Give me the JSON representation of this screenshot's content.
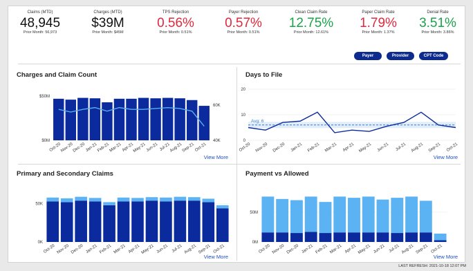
{
  "kpis": [
    {
      "title": "Claims (MTD)",
      "value": "48,945",
      "prior": "Prior Month: 56,973",
      "color": "black"
    },
    {
      "title": "Charges (MTD)",
      "value": "$39M",
      "prior": "Prior Month: $45M",
      "color": "black"
    },
    {
      "title": "TPS Rejection",
      "value": "0.56%",
      "prior": "Prior Month: 0.51%",
      "color": "red"
    },
    {
      "title": "Payer Rejection",
      "value": "0.57%",
      "prior": "Prior Month: 0.51%",
      "color": "red"
    },
    {
      "title": "Clean Claim Rate",
      "value": "12.75%",
      "prior": "Prior Month: 12.61%",
      "color": "green"
    },
    {
      "title": "Paper Claim Rate",
      "value": "1.79%",
      "prior": "Prior Month: 1.37%",
      "color": "red"
    },
    {
      "title": "Denial Rate",
      "value": "3.51%",
      "prior": "Prior Month: 3.86%",
      "color": "green"
    }
  ],
  "filters": {
    "payer": "Payer",
    "provider": "Provider",
    "cpt_code": "CPT Code"
  },
  "view_more": "View More",
  "last_refresh": "LAST REFRESH: 2021-10-18 12:07 PM",
  "colors": {
    "dark_blue": "#0b2a9e",
    "light_blue": "#5cb3f3",
    "line_blue": "#5aaee8",
    "dtf_line": "#0b2a9e",
    "dtf_avg": "#3b7bd1",
    "red": "#e0283c",
    "green": "#1aa34a"
  },
  "chart_data": [
    {
      "type": "bar",
      "title": "Charges and Claim Count",
      "categories": [
        "Oct-20",
        "Nov-20",
        "Dec-20",
        "Jan-21",
        "Feb-21",
        "Mar-21",
        "Apr-21",
        "May-21",
        "Jun-21",
        "Jul-21",
        "Aug-21",
        "Sep-21",
        "Oct-21"
      ],
      "series": [
        {
          "kind": "bar",
          "axis": "left",
          "values": [
            47,
            46,
            48,
            47.5,
            43,
            47,
            47,
            48,
            47.5,
            48,
            47.5,
            45.5,
            39
          ]
        },
        {
          "kind": "line",
          "axis": "right",
          "values": [
            57.5,
            56,
            57.5,
            58.5,
            56.5,
            58.5,
            57.5,
            57.5,
            58,
            58.5,
            58,
            56.5,
            48
          ]
        }
      ],
      "ylim": [
        0,
        50
      ],
      "y2lim": [
        40,
        65
      ],
      "yticks": [
        "$0M",
        "$50M"
      ],
      "y2ticks": [
        "40K",
        "60K"
      ],
      "xlabel": "",
      "ylabel": ""
    },
    {
      "type": "line",
      "title": "Days to File",
      "categories": [
        "Oct-20",
        "Nov-20",
        "Dec-20",
        "Jan-21",
        "Feb-21",
        "Mar-21",
        "Apr-21",
        "May-21",
        "Jun-21",
        "Jul-21",
        "Aug-21",
        "Sep-21",
        "Oct-21"
      ],
      "series": [
        {
          "values": [
            5,
            4,
            7,
            7.5,
            11,
            3,
            4,
            3.5,
            5.5,
            7,
            11,
            6,
            5
          ]
        }
      ],
      "average": 6,
      "average_label": "Avg: 6",
      "ylim": [
        0,
        20
      ],
      "yticks": [
        "0",
        "10",
        "20"
      ],
      "xlabel": "",
      "ylabel": ""
    },
    {
      "type": "bar",
      "stacked": true,
      "title": "Primary and Secondary Claims",
      "categories": [
        "Oct-20",
        "Nov-20",
        "Dec-20",
        "Jan-21",
        "Feb-21",
        "Mar-21",
        "Apr-21",
        "May-21",
        "Jun-21",
        "Jul-21",
        "Aug-21",
        "Sep-21",
        "Oct-21"
      ],
      "series": [
        {
          "values": [
            53,
            52,
            54,
            53,
            48,
            53,
            53,
            54,
            53,
            54,
            54,
            52,
            44
          ]
        },
        {
          "values": [
            5,
            5,
            5,
            4.5,
            4,
            5,
            4.5,
            4.5,
            5,
            5,
            4.5,
            4.5,
            4
          ]
        }
      ],
      "ylim": [
        0,
        65
      ],
      "yticks": [
        "0K",
        "50K"
      ],
      "xlabel": "",
      "ylabel": ""
    },
    {
      "type": "bar",
      "stacked": true,
      "title": "Payment vs Allowed",
      "categories": [
        "Oct-20",
        "Nov-20",
        "Dec-20",
        "Jan-21",
        "Feb-21",
        "Mar-21",
        "Apr-21",
        "May-21",
        "Jun-21",
        "Jul-21",
        "Aug-21",
        "Sep-21",
        "Oct-21"
      ],
      "series": [
        {
          "values": [
            16,
            16,
            15,
            17,
            15,
            16,
            16,
            16,
            16,
            15,
            16,
            16,
            3
          ]
        },
        {
          "values": [
            60,
            56,
            55,
            59,
            52,
            60,
            58,
            60,
            55,
            59,
            60,
            53,
            11
          ]
        }
      ],
      "ylim": [
        0,
        88
      ],
      "yticks": [
        "0M",
        "50M"
      ],
      "xlabel": "",
      "ylabel": ""
    }
  ]
}
